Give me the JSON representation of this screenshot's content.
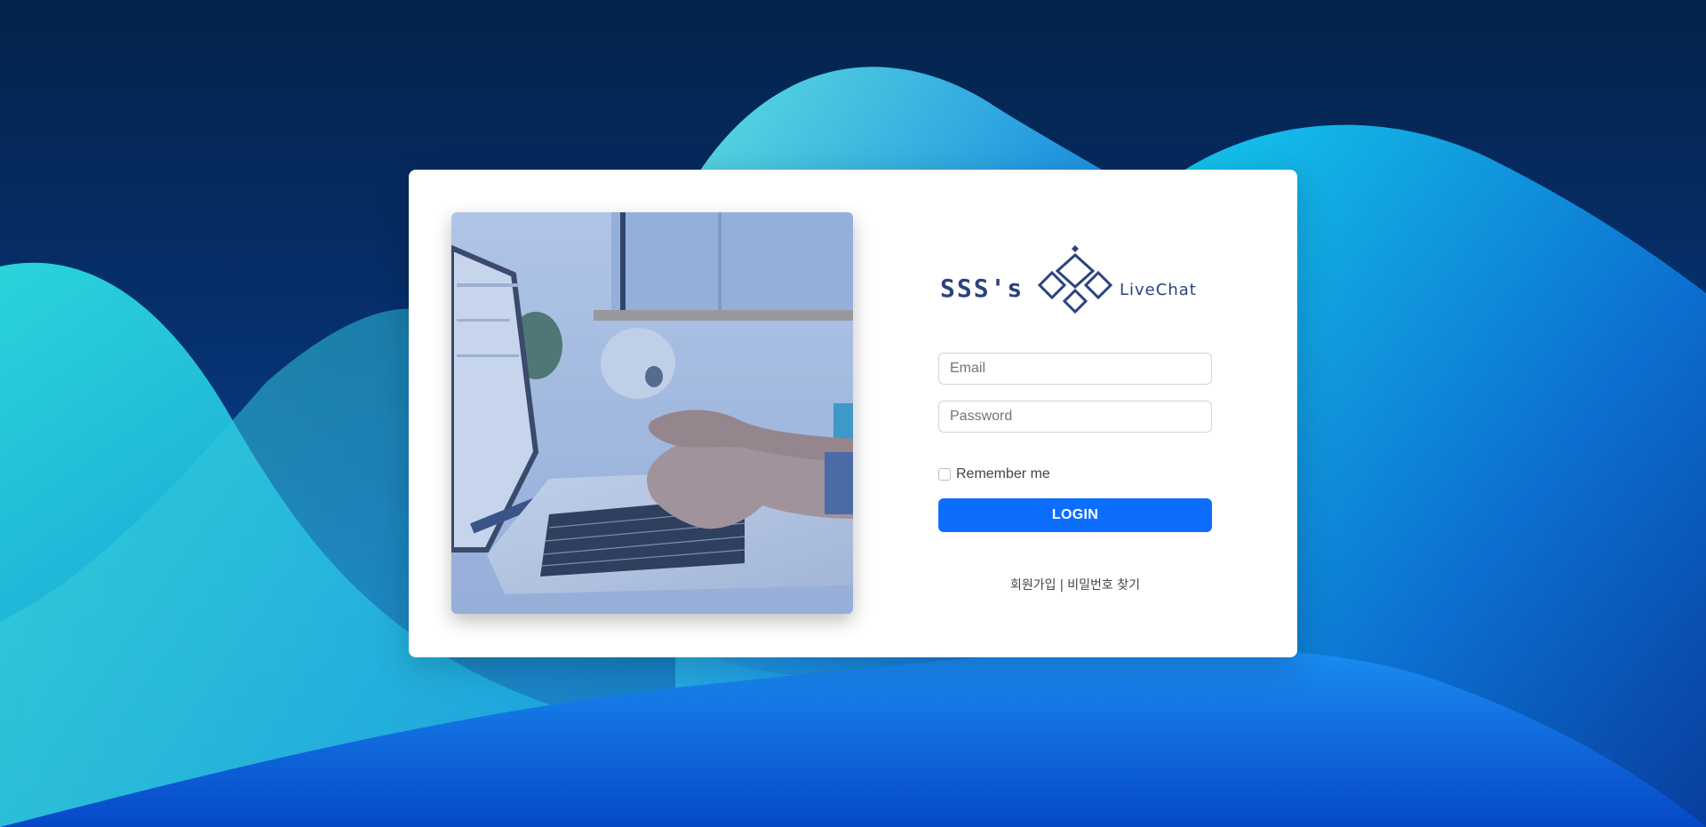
{
  "logo": {
    "left_text": "SSS's",
    "right_text": "LiveChat",
    "color": "#2b4280"
  },
  "form": {
    "email_placeholder": "Email",
    "password_placeholder": "Password",
    "remember_label": "Remember me",
    "login_label": "LOGIN"
  },
  "links": {
    "signup": "회원가입",
    "separator": "|",
    "find_password": "비밀번호 찾기"
  },
  "colors": {
    "primary": "#0d6efd",
    "background_dark": "#04234a",
    "wave_teal": "#3fd0d6",
    "wave_blue": "#0a6ee0"
  }
}
